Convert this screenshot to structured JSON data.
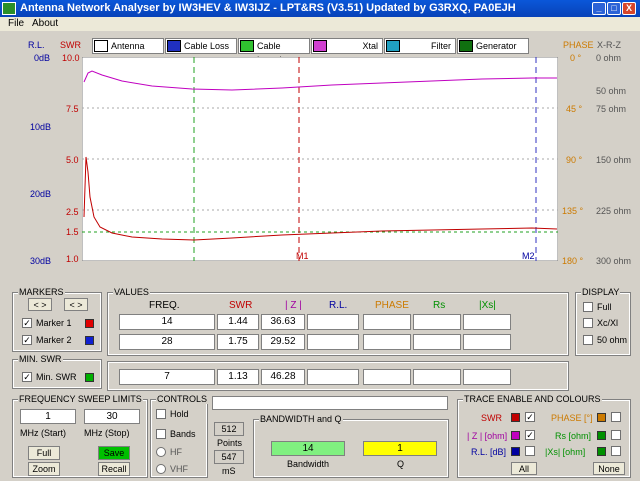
{
  "window": {
    "title": "Antenna Network Analyser by IW3HEV & IW3IJZ - LPT&RS (V3.51)  Updated by G3RXQ, PA0EJH",
    "btn_min": "_",
    "btn_max": "□",
    "btn_close": "X"
  },
  "menu": {
    "file": "File",
    "about": "About"
  },
  "toolbar": {
    "antenna": "Antenna",
    "cable_loss": "Cable Loss",
    "cable_length": "Cable Length",
    "xtal": "Xtal",
    "filter": "Filter",
    "generator": "Generator"
  },
  "axes": {
    "rl_title": "R.L.",
    "swr_title": "SWR",
    "phase_title": "PHASE",
    "xrz_title": "X-R-Z",
    "rl": [
      "0dB",
      "10dB",
      "20dB",
      "30dB"
    ],
    "swr": [
      "10.0",
      "7.5",
      "5.0",
      "2.5",
      "1.5",
      "1.0"
    ],
    "phase": [
      "0 °",
      "45 °",
      "90 °",
      "135 °",
      "180 °"
    ],
    "ohm": [
      "0 ohm",
      "50 ohm",
      "75 ohm",
      "150 ohm",
      "225 ohm",
      "300 ohm"
    ],
    "m1": "M1",
    "m2": "M2"
  },
  "markers": {
    "title": "MARKERS",
    "prev": "< >",
    "next": "< >",
    "m1": "Marker 1",
    "m2": "Marker 2",
    "check": "✓"
  },
  "values": {
    "title": "VALUES",
    "h_freq": "FREQ.",
    "h_swr": "SWR",
    "h_z": "| Z |",
    "h_rl": "R.L.",
    "h_phase": "PHASE",
    "h_rs": "Rs",
    "h_xs": "|Xs|",
    "r1": {
      "freq": "14",
      "swr": "1.44",
      "z": "36.63"
    },
    "r2": {
      "freq": "28",
      "swr": "1.75",
      "z": "29.52"
    },
    "r3": {
      "freq": "7",
      "swr": "1.13",
      "z": "46.28"
    }
  },
  "display": {
    "title": "DISPLAY",
    "full": "Full",
    "xc": "Xc/Xl",
    "ohm50": "50 ohm"
  },
  "minswr": {
    "title": "MIN. SWR",
    "label": "Min. SWR"
  },
  "sweep": {
    "title": "FREQUENCY SWEEP LIMITS",
    "start": "1",
    "stop": "30",
    "start_lbl": "MHz (Start)",
    "stop_lbl": "MHz (Stop)",
    "full": "Full",
    "save": "Save",
    "zoom": "Zoom",
    "recall": "Recall"
  },
  "controls": {
    "title": "CONTROLS",
    "hold": "Hold",
    "bands": "Bands",
    "hf": "HF",
    "vhf": "VHF",
    "points": "512",
    "points_lbl": "Points",
    "ms": "547",
    "ms_lbl": "mS"
  },
  "bandwidth": {
    "title": "BANDWIDTH and Q",
    "bw": "14",
    "bw_lbl": "Bandwidth",
    "q": "1",
    "q_lbl": "Q"
  },
  "trace": {
    "title": "TRACE ENABLE AND COLOURS",
    "swr": "SWR",
    "phase": "PHASE [°]",
    "z": "| Z | [ohm]",
    "rs": "Rs [ohm]",
    "rl": "R.L. [dB]",
    "xs": "|Xs| [ohm]",
    "all": "All",
    "none": "None"
  },
  "colors": {
    "swr": "#c00000",
    "z": "#c000c0",
    "rl": "#0000a0",
    "phase": "#cc7a00",
    "rs": "#009000",
    "xs": "#009000"
  }
}
